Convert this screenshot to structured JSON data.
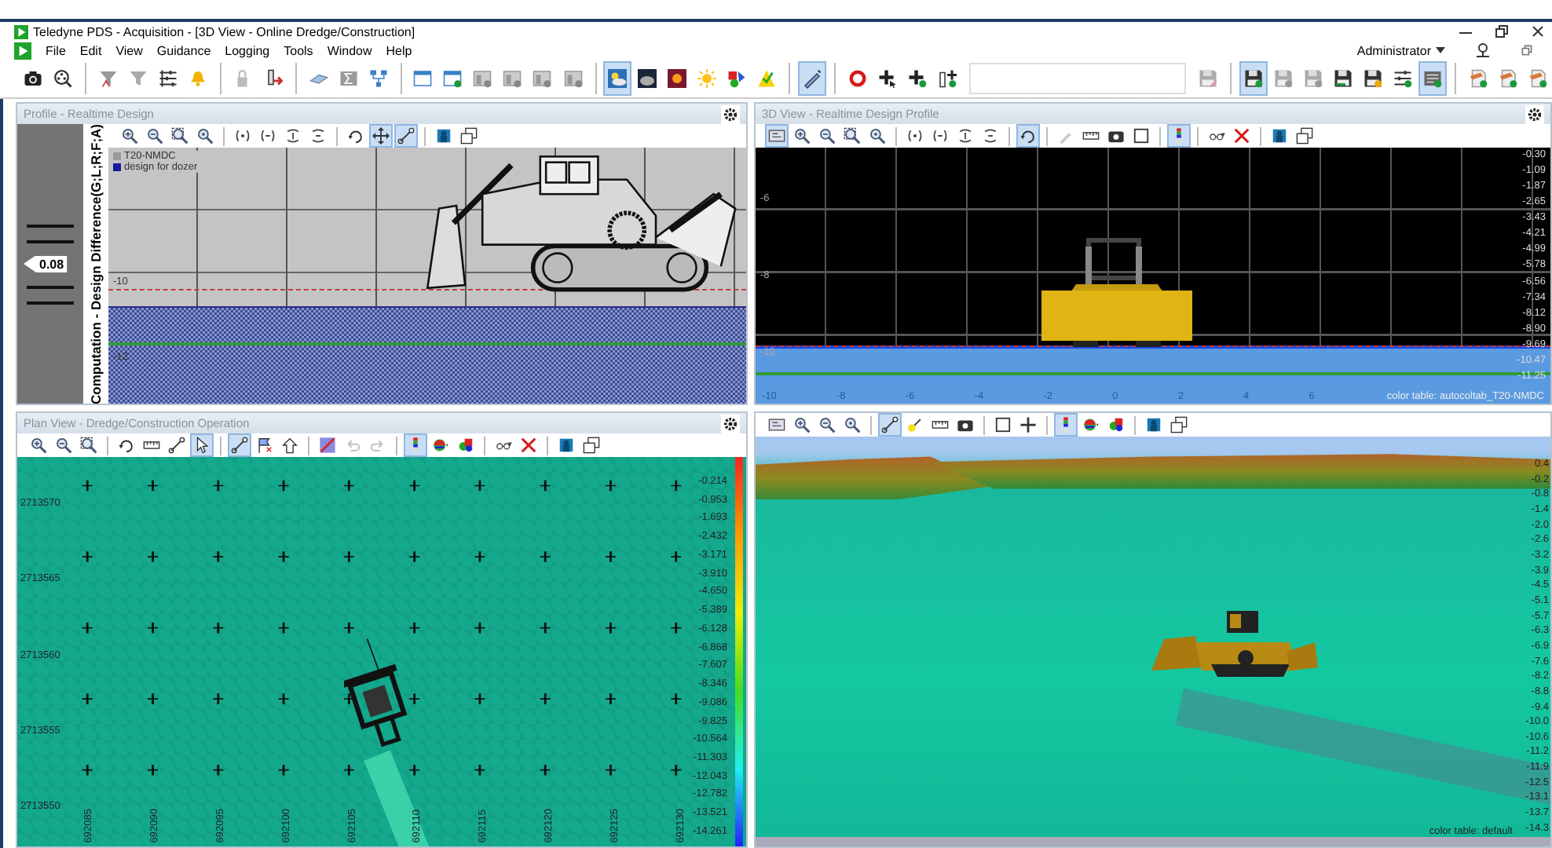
{
  "window": {
    "title": "Teledyne PDS - Acquisition - [3D View - Online Dredge/Construction]",
    "user": "Administrator"
  },
  "menu": [
    "File",
    "Edit",
    "View",
    "Guidance",
    "Logging",
    "Tools",
    "Window",
    "Help"
  ],
  "main_toolbar": {
    "left": [
      [
        {
          "kind": "camera",
          "selected": false
        },
        {
          "kind": "film",
          "selected": false
        }
      ],
      [
        {
          "kind": "funnel-a",
          "selected": false
        },
        {
          "kind": "funnel",
          "selected": false
        },
        {
          "kind": "sliders",
          "selected": false
        },
        {
          "kind": "bell",
          "selected": false
        }
      ],
      [
        {
          "kind": "lock",
          "selected": false
        },
        {
          "kind": "pen-arrow",
          "selected": false
        }
      ],
      [
        {
          "kind": "slab",
          "selected": false
        },
        {
          "kind": "sigma",
          "selected": false
        },
        {
          "kind": "tree",
          "selected": false
        }
      ],
      [
        {
          "kind": "window",
          "selected": false
        },
        {
          "kind": "window-add",
          "selected": false
        },
        {
          "kind": "window-gray",
          "selected": false
        },
        {
          "kind": "window-gray",
          "selected": false
        },
        {
          "kind": "window-gray",
          "selected": false
        },
        {
          "kind": "window-gray",
          "selected": false
        }
      ],
      [
        {
          "kind": "sky-day",
          "selected": true
        },
        {
          "kind": "sky-night",
          "selected": false
        },
        {
          "kind": "sky-sun",
          "selected": false
        },
        {
          "kind": "sun",
          "selected": false
        },
        {
          "kind": "shapes",
          "selected": false
        },
        {
          "kind": "warning",
          "selected": false
        }
      ],
      [
        {
          "kind": "probe",
          "selected": true
        }
      ],
      [
        {
          "kind": "ring",
          "selected": false
        },
        {
          "kind": "cross-cursor",
          "selected": false
        },
        {
          "kind": "cross-add",
          "selected": false
        },
        {
          "kind": "pin-add",
          "selected": false
        }
      ]
    ],
    "right": [
      [
        {
          "kind": "save-edit",
          "selected": false
        }
      ],
      [
        {
          "kind": "save-check",
          "selected": true
        },
        {
          "kind": "save-gray",
          "selected": false
        },
        {
          "kind": "save-gray",
          "selected": false
        },
        {
          "kind": "save-arrow",
          "selected": false
        },
        {
          "kind": "save-warn",
          "selected": false
        },
        {
          "kind": "sliders-check",
          "selected": false
        },
        {
          "kind": "list-check",
          "selected": true
        }
      ],
      [
        {
          "kind": "doc-add",
          "selected": false
        },
        {
          "kind": "doc-add",
          "selected": false
        },
        {
          "kind": "doc-add",
          "selected": false
        }
      ]
    ]
  },
  "profile": {
    "title": "Profile - Realtime Design",
    "gauge_value": "0.08",
    "axis_label": "Computation - Design Difference(G;L;R;F;A)",
    "toolbar": [
      [
        {
          "kind": "zoom-in",
          "selected": false
        },
        {
          "kind": "zoom-out",
          "selected": false
        },
        {
          "kind": "zoom-box",
          "selected": false
        },
        {
          "kind": "zoom-fit",
          "selected": false
        }
      ],
      [
        {
          "kind": "expand-h",
          "selected": false
        },
        {
          "kind": "shrink-h",
          "selected": false
        },
        {
          "kind": "expand-v",
          "selected": false
        },
        {
          "kind": "shrink-v",
          "selected": false
        }
      ],
      [
        {
          "kind": "rotate",
          "selected": false
        },
        {
          "kind": "move",
          "selected": true
        },
        {
          "kind": "measure",
          "selected": true
        }
      ],
      [
        {
          "kind": "layers",
          "selected": false
        },
        {
          "kind": "windows",
          "selected": false
        }
      ]
    ],
    "legend": [
      {
        "label": "T20-NMDC",
        "color": "#9a9a9a"
      },
      {
        "label": "design for dozer",
        "color": "#1a1aa0"
      }
    ],
    "y_ticks": [
      "-10",
      "-12"
    ]
  },
  "view3d": {
    "title": "3D View - Realtime Design Profile",
    "toolbar": [
      [
        {
          "kind": "home",
          "selected": true
        },
        {
          "kind": "zoom-in",
          "selected": false
        },
        {
          "kind": "zoom-out",
          "selected": false
        },
        {
          "kind": "zoom-box",
          "selected": false
        },
        {
          "kind": "zoom-fit",
          "selected": false
        }
      ],
      [
        {
          "kind": "expand-h",
          "selected": false
        },
        {
          "kind": "shrink-h",
          "selected": false
        },
        {
          "kind": "expand-v",
          "selected": false
        },
        {
          "kind": "shrink-v",
          "selected": false
        }
      ],
      [
        {
          "kind": "rotate",
          "selected": true
        }
      ],
      [
        {
          "kind": "pencil",
          "selected": false
        },
        {
          "kind": "ruler",
          "selected": false
        },
        {
          "kind": "camera-small",
          "selected": false
        },
        {
          "kind": "rect",
          "selected": false
        }
      ],
      [
        {
          "kind": "colorbar",
          "selected": true
        }
      ],
      [
        {
          "kind": "glasses",
          "selected": false
        },
        {
          "kind": "close-x",
          "selected": false
        }
      ],
      [
        {
          "kind": "layers",
          "selected": false
        },
        {
          "kind": "windows",
          "selected": false
        }
      ]
    ],
    "y_ticks": [
      "-6",
      "-8",
      "-10"
    ],
    "x_ticks": [
      "-10",
      "-8",
      "-6",
      "-4",
      "-2",
      "0",
      "2",
      "4",
      "6"
    ],
    "scale_labels": [
      "-0.30",
      "-1.09",
      "-1.87",
      "-2.65",
      "-3.43",
      "-4.21",
      "-4.99",
      "-5.78",
      "-6.56",
      "-7.34",
      "-8.12",
      "-8.90",
      "-9.69",
      "-10.47",
      "-11.25"
    ],
    "color_table": "color table: autocoltab_T20-NMDC"
  },
  "plan": {
    "title": "Plan View - Dredge/Construction Operation",
    "toolbar": [
      [
        {
          "kind": "zoom-in",
          "selected": false
        },
        {
          "kind": "zoom-out",
          "selected": false
        },
        {
          "kind": "zoom-box",
          "selected": false
        }
      ],
      [
        {
          "kind": "rotate",
          "selected": false
        },
        {
          "kind": "ruler",
          "selected": false
        },
        {
          "kind": "measure",
          "selected": false
        },
        {
          "kind": "cursor",
          "selected": true
        }
      ],
      [
        {
          "kind": "measure",
          "selected": true
        },
        {
          "kind": "flag",
          "selected": false
        },
        {
          "kind": "house",
          "selected": false
        }
      ],
      [
        {
          "kind": "palette-edit",
          "selected": false
        },
        {
          "kind": "undo",
          "selected": false
        },
        {
          "kind": "redo",
          "selected": false
        }
      ],
      [
        {
          "kind": "colorbar",
          "selected": true
        },
        {
          "kind": "palette",
          "selected": false
        },
        {
          "kind": "shapes-small",
          "selected": false
        }
      ],
      [
        {
          "kind": "glasses",
          "selected": false
        },
        {
          "kind": "close-x",
          "selected": false
        }
      ],
      [
        {
          "kind": "layers",
          "selected": false
        },
        {
          "kind": "windows",
          "selected": false
        }
      ]
    ],
    "northings": [
      "2713570",
      "2713565",
      "2713560",
      "2713555",
      "2713550"
    ],
    "eastings": [
      "692085",
      "692090",
      "692095",
      "692100",
      "692105",
      "692110",
      "692115",
      "692120",
      "692125",
      "692130"
    ],
    "scale_labels": [
      "-0.214",
      "-0.953",
      "-1.693",
      "-2.432",
      "-3.171",
      "-3.910",
      "-4.650",
      "-5.389",
      "-6.128",
      "-6.868",
      "-7.607",
      "-8.346",
      "-9.086",
      "-9.825",
      "-10.564",
      "-11.303",
      "-12.043",
      "-12.782",
      "-13.521",
      "-14.261"
    ]
  },
  "scene": {
    "toolbar": [
      [
        {
          "kind": "home",
          "selected": false
        },
        {
          "kind": "zoom-in",
          "selected": false
        },
        {
          "kind": "zoom-out",
          "selected": false
        },
        {
          "kind": "zoom-fit",
          "selected": false
        }
      ],
      [
        {
          "kind": "measure",
          "selected": true
        },
        {
          "kind": "measure-yellow",
          "selected": false
        },
        {
          "kind": "ruler",
          "selected": false
        },
        {
          "kind": "camera-small",
          "selected": false
        }
      ],
      [
        {
          "kind": "rect",
          "selected": false
        },
        {
          "kind": "plus-cross",
          "selected": false
        }
      ],
      [
        {
          "kind": "colorbar",
          "selected": true
        },
        {
          "kind": "palette",
          "selected": false
        },
        {
          "kind": "shapes-small",
          "selected": false
        }
      ],
      [
        {
          "kind": "layers",
          "selected": false
        },
        {
          "kind": "windows",
          "selected": false
        }
      ]
    ],
    "scale_labels": [
      "0.4",
      "-0.2",
      "-0.8",
      "-1.4",
      "-2.0",
      "-2.6",
      "-3.2",
      "-3.9",
      "-4.5",
      "-5.1",
      "-5.7",
      "-6.3",
      "-6.9",
      "-7.6",
      "-8.2",
      "-8.8",
      "-9.4",
      "-10.0",
      "-10.6",
      "-11.2",
      "-11.9",
      "-12.5",
      "-13.1",
      "-13.7",
      "-14.3"
    ],
    "color_table": "color table: default"
  }
}
